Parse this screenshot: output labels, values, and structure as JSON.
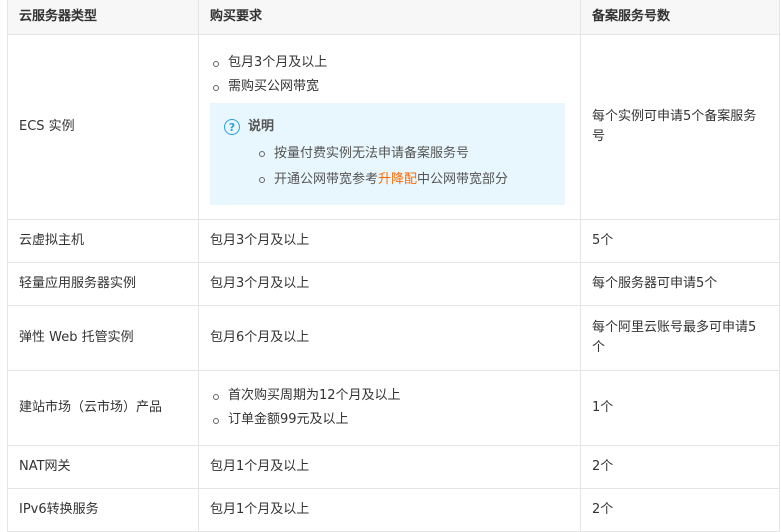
{
  "headers": [
    "云服务器类型",
    "购买要求",
    "备案服务号数"
  ],
  "rows": [
    {
      "type": "ECS 实例",
      "requirements": [
        "包月3个月及以上",
        "需购买公网带宽"
      ],
      "note": {
        "title": "说明",
        "items": [
          {
            "text": "按量付费实例无法申请备案服务号"
          },
          {
            "before": "开通公网带宽参考",
            "link": "升降配",
            "after": "中公网带宽部分"
          }
        ]
      },
      "count": "每个实例可申请5个备案服务号"
    },
    {
      "type": "云虚拟主机",
      "requirement": "包月3个月及以上",
      "count": "5个"
    },
    {
      "type": "轻量应用服务器实例",
      "requirement": "包月3个月及以上",
      "count": "每个服务器可申请5个"
    },
    {
      "type": "弹性 Web 托管实例",
      "requirement": "包月6个月及以上",
      "count": "每个阿里云账号最多可申请5个"
    },
    {
      "type": "建站市场（云市场）产品",
      "requirements": [
        "首次购买周期为12个月及以上",
        "订单金额99元及以上"
      ],
      "count": "1个"
    },
    {
      "type": "NAT网关",
      "requirement": "包月1个月及以上",
      "count": "2个"
    },
    {
      "type": "IPv6转换服务",
      "requirement": "包月1个月及以上",
      "count": "2个"
    }
  ]
}
